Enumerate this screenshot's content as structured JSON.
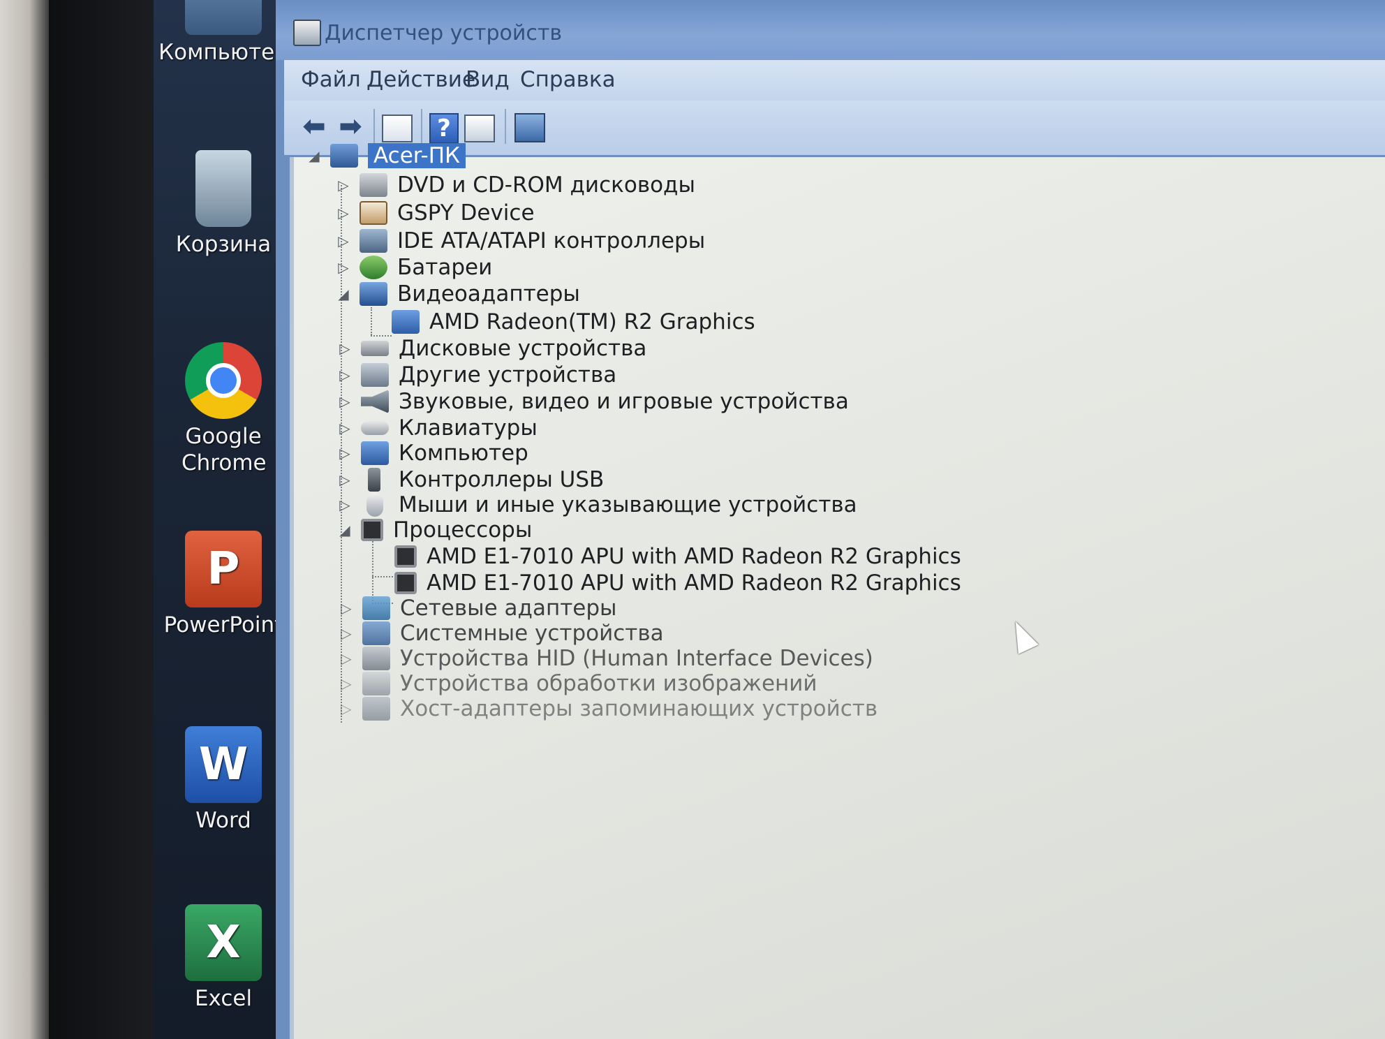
{
  "desktop": {
    "icons": [
      {
        "label": "Компьютер",
        "icon": "computer-icon"
      },
      {
        "label": "Корзина",
        "icon": "recycle-bin-icon"
      },
      {
        "label": "Google Chrome",
        "icon": "chrome-icon"
      },
      {
        "label": "PowerPoint",
        "icon": "powerpoint-icon"
      },
      {
        "label": "Word",
        "icon": "word-icon"
      },
      {
        "label": "Excel",
        "icon": "excel-icon"
      }
    ]
  },
  "window": {
    "title": "Диспетчер устройств",
    "menu": [
      "Файл",
      "Действие",
      "Вид",
      "Справка"
    ],
    "toolbar": [
      "back-arrow-icon",
      "forward-arrow-icon",
      "properties-icon",
      "help-icon",
      "update-driver-icon",
      "scan-hardware-icon"
    ],
    "toolbar_glyphs": {
      "back": "⬅",
      "forward": "➡",
      "help": "?"
    }
  },
  "tree": {
    "root": "Acer-ПК",
    "items": [
      {
        "label": "DVD и CD-ROM дисководы",
        "icon": "dvd-drive-icon",
        "expander": "▷"
      },
      {
        "label": "GSPY Device",
        "icon": "gspy-device-icon",
        "expander": "▷"
      },
      {
        "label": "IDE ATA/ATAPI контроллеры",
        "icon": "ide-controller-icon",
        "expander": "▷"
      },
      {
        "label": "Батареи",
        "icon": "battery-icon",
        "expander": "▷"
      },
      {
        "label": "Видеоадаптеры",
        "icon": "display-adapter-icon",
        "expander": "◢"
      },
      {
        "label": "AMD Radeon(TM) R2 Graphics",
        "icon": "gpu-icon",
        "expander": ""
      },
      {
        "label": "Дисковые устройства",
        "icon": "disk-drive-icon",
        "expander": "▷"
      },
      {
        "label": "Другие устройства",
        "icon": "other-devices-icon",
        "expander": "▷"
      },
      {
        "label": "Звуковые, видео и игровые устройства",
        "icon": "sound-icon",
        "expander": "▷"
      },
      {
        "label": "Клавиатуры",
        "icon": "keyboard-icon",
        "expander": "▷"
      },
      {
        "label": "Компьютер",
        "icon": "computer-icon",
        "expander": "▷"
      },
      {
        "label": "Контроллеры USB",
        "icon": "usb-icon",
        "expander": "▷"
      },
      {
        "label": "Мыши и иные указывающие устройства",
        "icon": "mouse-icon",
        "expander": "▷"
      },
      {
        "label": "Процессоры",
        "icon": "processor-icon",
        "expander": "◢"
      },
      {
        "label": "AMD E1-7010 APU with AMD Radeon R2 Graphics",
        "icon": "cpu-icon",
        "expander": ""
      },
      {
        "label": "AMD E1-7010 APU with AMD Radeon R2 Graphics",
        "icon": "cpu-icon",
        "expander": ""
      },
      {
        "label": "Сетевые адаптеры",
        "icon": "network-adapter-icon",
        "expander": "▷"
      },
      {
        "label": "Системные устройства",
        "icon": "system-devices-icon",
        "expander": "▷"
      },
      {
        "label": "Устройства HID (Human Interface Devices)",
        "icon": "hid-icon",
        "expander": "▷"
      },
      {
        "label": "Устройства обработки изображений",
        "icon": "imaging-devices-icon",
        "expander": "▷"
      },
      {
        "label": "Хост-адаптеры запоминающих устройств",
        "icon": "storage-controller-icon",
        "expander": "▷"
      }
    ],
    "root_expander": "◢"
  }
}
